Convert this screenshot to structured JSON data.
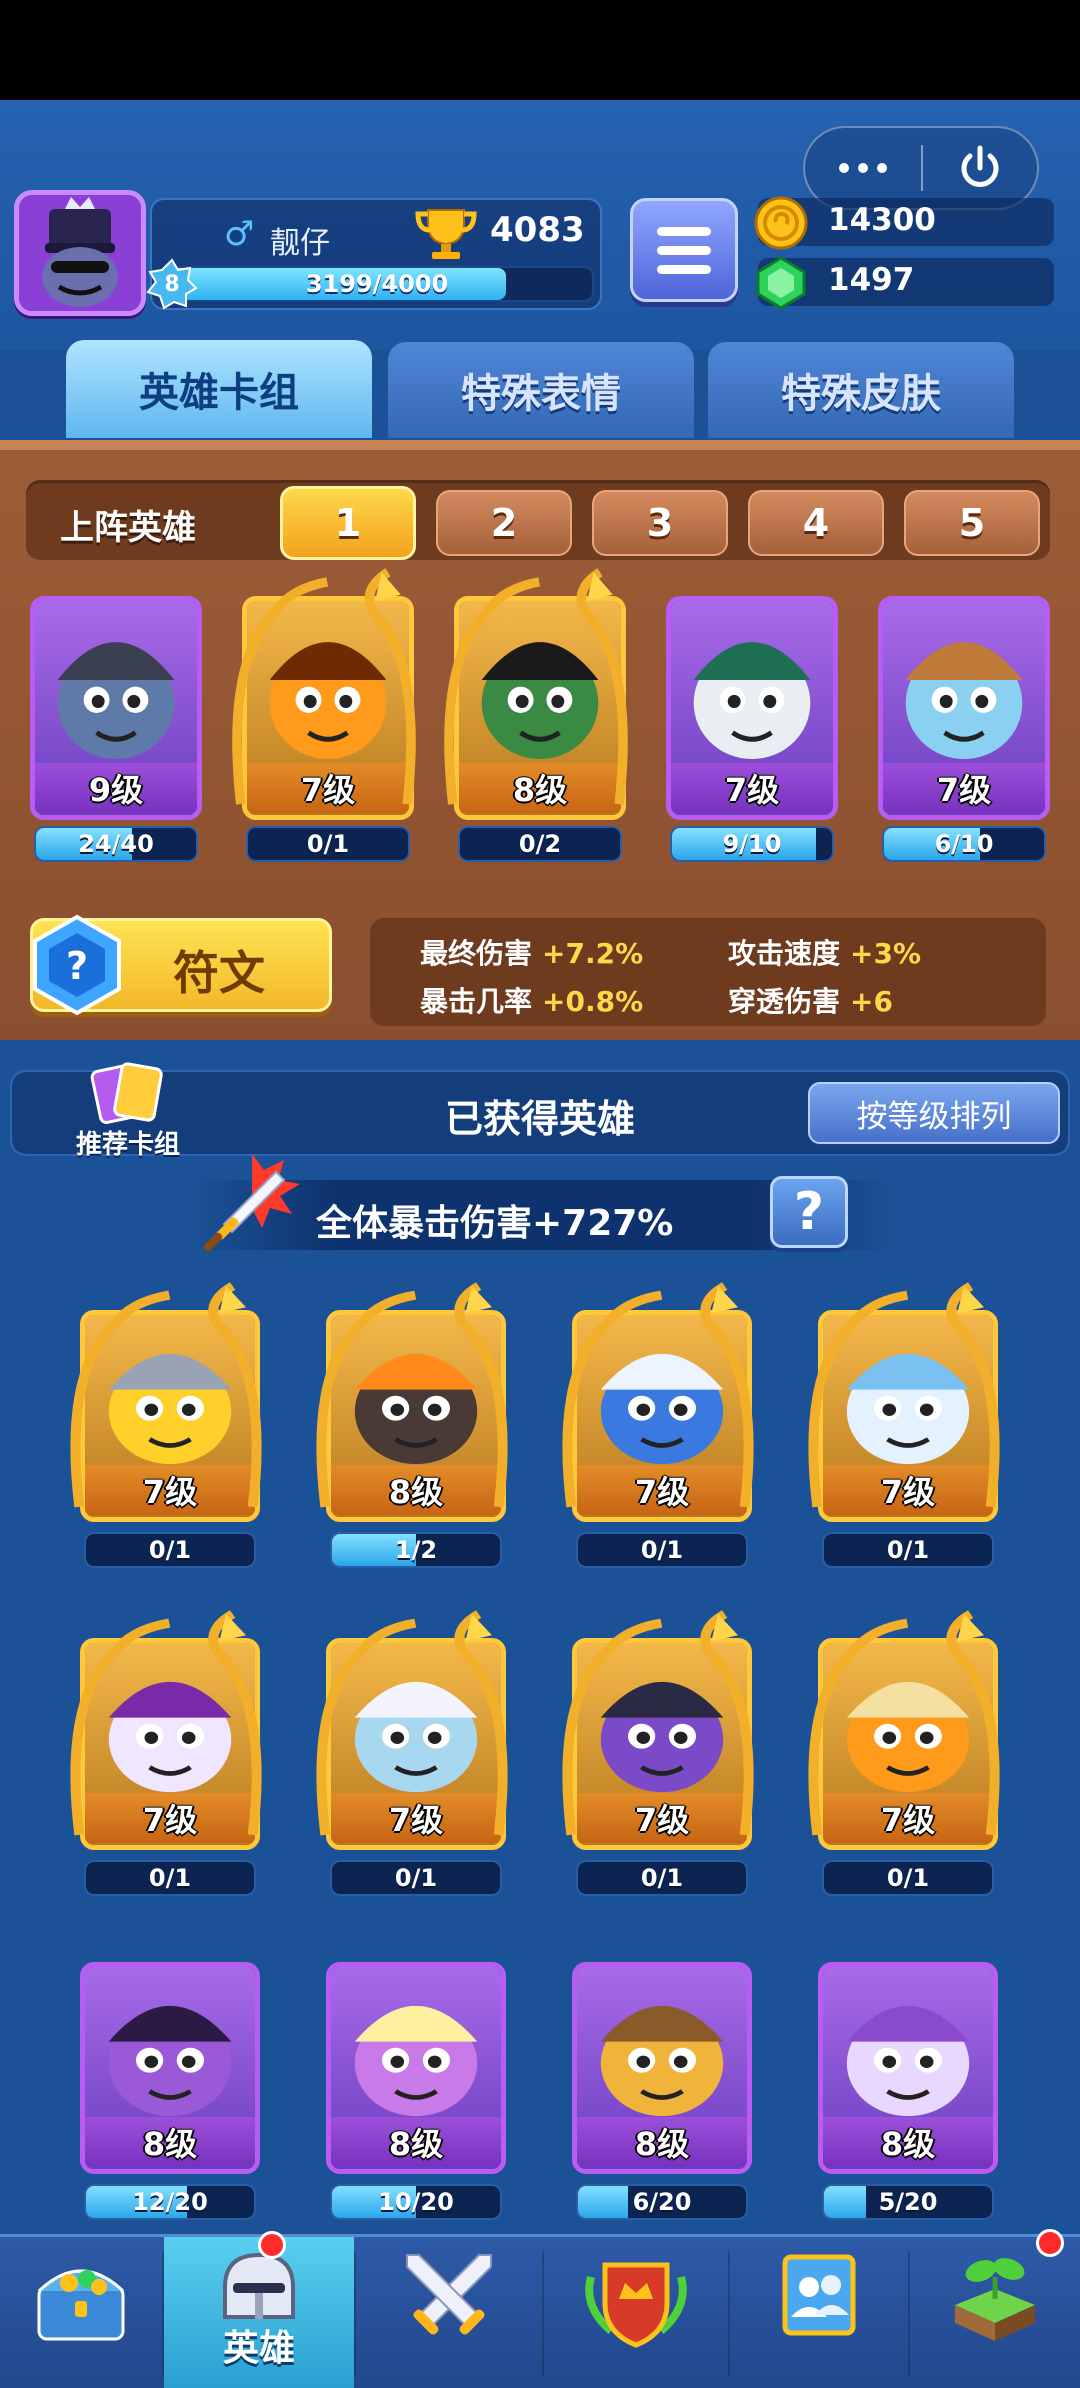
{
  "profile": {
    "gender_symbol": "♂",
    "name": "靓仔",
    "trophies": "4083",
    "level": "8",
    "xp_text": "3199/4000",
    "xp_fraction": 0.8
  },
  "currency": {
    "gold": "14300",
    "gems": "1497"
  },
  "tabs": [
    {
      "label": "英雄卡组",
      "active": true
    },
    {
      "label": "特殊表情",
      "active": false
    },
    {
      "label": "特殊皮肤",
      "active": false
    }
  ],
  "lineup": {
    "title": "上阵英雄",
    "slots": [
      "1",
      "2",
      "3",
      "4",
      "5"
    ],
    "active_slot": "1",
    "heroes": [
      {
        "level": "9级",
        "progress": "24/40",
        "fraction": 0.6,
        "rarity": "epic",
        "icon": "burglar-mole-icon"
      },
      {
        "level": "7级",
        "progress": "0/1",
        "fraction": 0,
        "rarity": "legend",
        "icon": "pumpkin-hero-icon"
      },
      {
        "level": "8级",
        "progress": "0/2",
        "fraction": 0,
        "rarity": "legend",
        "icon": "goblin-hero-icon"
      },
      {
        "level": "7级",
        "progress": "9/10",
        "fraction": 0.9,
        "rarity": "epic",
        "icon": "skull-cowboy-icon"
      },
      {
        "level": "7级",
        "progress": "6/10",
        "fraction": 0.6,
        "rarity": "epic",
        "icon": "ice-mage-icon"
      }
    ]
  },
  "rune": {
    "label": "符文"
  },
  "stats": [
    {
      "name": "最终伤害",
      "value": "+7.2%"
    },
    {
      "name": "攻击速度",
      "value": "+3%"
    },
    {
      "name": "暴击几率",
      "value": "+0.8%"
    },
    {
      "name": "穿透伤害",
      "value": "+6"
    }
  ],
  "collection": {
    "recommend_label": "推荐卡组",
    "title": "已获得英雄",
    "sort_label": "按等级排列",
    "crit_text": "全体暴击伤害+727%",
    "help_label": "?",
    "heroes": [
      {
        "level": "7级",
        "progress": "0/1",
        "fraction": 0,
        "rarity": "legend",
        "icon": "knight-robot-icon"
      },
      {
        "level": "8级",
        "progress": "1/2",
        "fraction": 0.5,
        "rarity": "legend",
        "icon": "lava-golem-icon"
      },
      {
        "level": "7级",
        "progress": "0/1",
        "fraction": 0,
        "rarity": "legend",
        "icon": "frost-king-icon"
      },
      {
        "level": "7级",
        "progress": "0/1",
        "fraction": 0,
        "rarity": "legend",
        "icon": "yeti-icon"
      },
      {
        "level": "7级",
        "progress": "0/1",
        "fraction": 0,
        "rarity": "legend",
        "icon": "skull-reaper-icon"
      },
      {
        "level": "7级",
        "progress": "0/1",
        "fraction": 0,
        "rarity": "legend",
        "icon": "zeus-icon"
      },
      {
        "level": "7级",
        "progress": "0/1",
        "fraction": 0,
        "rarity": "legend",
        "icon": "octopus-pirate-icon"
      },
      {
        "level": "7级",
        "progress": "0/1",
        "fraction": 0,
        "rarity": "legend",
        "icon": "hooded-mage-icon"
      },
      {
        "level": "8级",
        "progress": "12/20",
        "fraction": 0.6,
        "rarity": "epic",
        "icon": "magician-icon"
      },
      {
        "level": "8级",
        "progress": "10/20",
        "fraction": 0.5,
        "rarity": "epic",
        "icon": "sorceress-icon"
      },
      {
        "level": "8级",
        "progress": "6/20",
        "fraction": 0.3,
        "rarity": "epic",
        "icon": "signpost-icon"
      },
      {
        "level": "8级",
        "progress": "5/20",
        "fraction": 0.25,
        "rarity": "epic",
        "icon": "skull-mage-icon"
      }
    ]
  },
  "nav": {
    "items": [
      {
        "icon": "treasure-chest-icon",
        "label": ""
      },
      {
        "icon": "helmet-icon",
        "label": "英雄",
        "active": true
      },
      {
        "icon": "crossed-swords-icon",
        "label": ""
      },
      {
        "icon": "guild-shield-icon",
        "label": ""
      },
      {
        "icon": "friends-icon",
        "label": ""
      },
      {
        "icon": "sprout-icon",
        "label": ""
      }
    ]
  },
  "colors": {
    "background": "#1b5196",
    "lineup_panel": "#9c5c37",
    "epic_frame": "#b85cf2",
    "legend_frame": "#ffc83a",
    "accent_yellow": "#ffd84a"
  }
}
